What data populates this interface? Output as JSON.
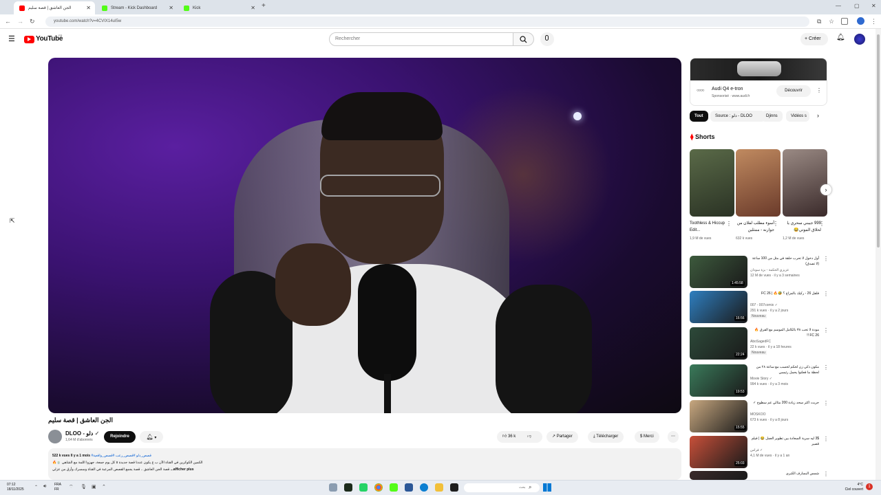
{
  "browser": {
    "tabs": [
      {
        "title": "الجن العاشق | قصة سليم",
        "active": true,
        "favicon_color": "#ff0000"
      },
      {
        "title": "Stream - Kick Dashboard",
        "active": false,
        "favicon_color": "#53fc18"
      },
      {
        "title": "Kick",
        "active": false,
        "favicon_color": "#53fc18"
      }
    ],
    "new_tab": "+",
    "url": "youtube.com/watch?v=4CVIX14uI5w"
  },
  "header": {
    "logo_text": "YouTube",
    "logo_sup": "FR",
    "search_placeholder": "Rechercher",
    "create_label": "Créer"
  },
  "video": {
    "title": "الجن العاشق | قصة سليم",
    "channel_name": "DLOO - دلو",
    "subscribers": "1,64 M d'abonnés",
    "join_label": "Rejoindre",
    "likes": "36 k",
    "share_label": "Partager",
    "download_label": "Télécharger",
    "thanks_label": "Merci"
  },
  "description": {
    "stats": "522 k vues  Il y a 1 mois",
    "hashtags": "#قصص_دلو #قصص_رعب #قصص_واقعية",
    "line1": "الكمين الكوكرين في القناة الآن ب ع يكون عندنا قصة جديدة ٥ كل يوم جمعة، جهزوا اللمة مع الشاهي 🍵🔥",
    "line2": "قصة الجن العاشق .. قصة يجمع القصص المرعبة في القناة وسسرك وأرق من عزلي",
    "more": "...afficher plus"
  },
  "sidebar": {
    "ad": {
      "title": "Audi Q4 e-tron",
      "sponsor": "Sponsorisé · www.audi.fr",
      "cta": "Découvrir"
    },
    "chips": [
      "Tout",
      "Source : دلو - DLOO",
      "Djinns",
      "Vidéos s"
    ],
    "shorts_heading": "Shorts",
    "shorts": [
      {
        "title": "Toothless & Hiccup Edit...",
        "views": "1,9 M de vues",
        "color": "#4a5a40"
      },
      {
        "title": "أسوء مطلب لفلان من جوارنه - ممثلين",
        "views": "632 k vues",
        "color": "#a06a4a"
      },
      {
        "title": "999 جيبني سحري يا لحلاق الموتي😂",
        "views": "1,2 M de vues",
        "color": "#7a6a64"
      }
    ],
    "recommended": [
      {
        "title": "أول دخول لا تحرب حلقة في مثل من 100 ساعة (لا تصدق)",
        "channel": "عزيزي الحكمة - بزة سودان",
        "meta": "12 M de vues · il y a 3 semaines",
        "duration": "1:45:58",
        "badge": "",
        "color": "#3d5a3d"
      },
      {
        "title": "فلفل 26 - ركيك بالمزاج ؟ 🤣🔥 | FC 26",
        "channel": "007 - 007comix ✓",
        "meta": "291 k vues · il y a 2 jours",
        "duration": "16:56",
        "badge": "Nouveau",
        "color": "#2f7fc0"
      },
      {
        "title": "مودة لا تحب ٨# بالكامل الموسم مع الفرق 🔥 FC 26 !!",
        "channel": "AboSagedFC",
        "meta": "22 k vues · il y a 18 heures",
        "duration": "22:24",
        "badge": "Nouveau",
        "color": "#2d4a3a"
      },
      {
        "title": "مكون ذكي زن لحكم لحسب مع ساعة ٢٨ من لحظة ما فعلتوا يحمل رئيسي",
        "channel": "Movie Story ✓",
        "meta": "994 k vues · il y a 3 mois",
        "duration": "19:53",
        "badge": "",
        "color": "#3a7a5a"
      },
      {
        "title": "جربت اكثر سحد زيادة 200 مثالي عم سطوح ✓",
        "channel": "MOSKOO",
        "meta": "673 k vues · il y a 8 jours",
        "duration": "15:55",
        "badge": "",
        "color": "#c8a880"
      },
      {
        "title": "3$ ليه سرية السعادة بين تطوير العمل 😂 | فيلم قصير",
        "channel": "فراس ✓",
        "meta": "4,1 M de vues · il y a 1 an",
        "duration": "25:03",
        "badge": "",
        "color": "#c8503a"
      },
      {
        "title": "شمس البسارف الكبرى",
        "channel": "",
        "meta": "",
        "duration": "",
        "badge": "",
        "color": "#3a2a2a"
      }
    ]
  },
  "taskbar": {
    "time": "07:12",
    "date": "18/11/2025",
    "lang": "FRA FR",
    "weather": "4°C",
    "weather_text": "Ciel couvert",
    "search_placeholder": "بحث",
    "notif": "1"
  }
}
